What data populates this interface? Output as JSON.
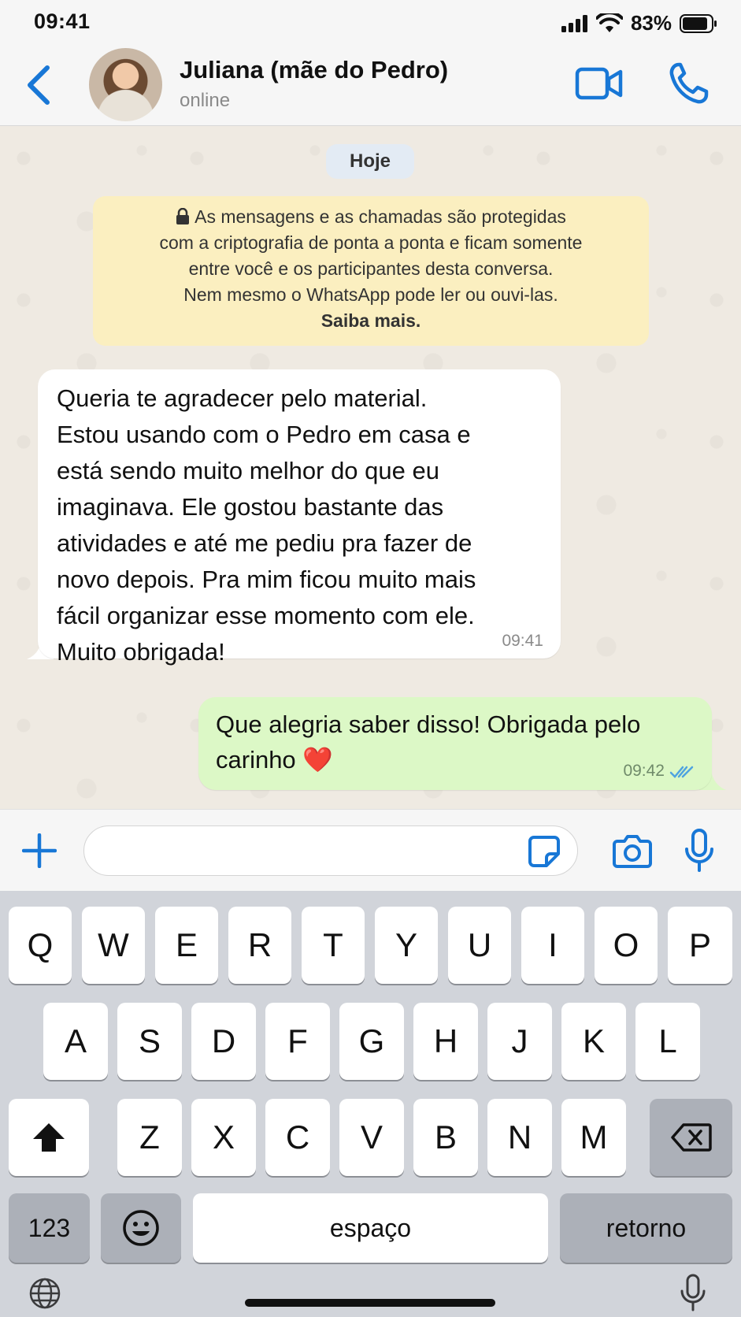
{
  "status_bar": {
    "time": "09:41",
    "battery": "83%"
  },
  "header": {
    "contact_name": "Juliana (mãe do Pedro)",
    "contact_status": "online"
  },
  "chat": {
    "date_chip": "Hoje",
    "encryption_notice": {
      "lines": [
        "As mensagens e as chamadas são protegidas",
        "com a criptografia de ponta a ponta e ficam somente",
        "entre você e os participantes desta conversa.",
        "Nem mesmo o WhatsApp pode ler ou ouvi-las."
      ],
      "learn_more": "Saiba mais."
    },
    "messages": [
      {
        "direction": "incoming",
        "lines": [
          "Queria te agradecer pelo material.",
          "Estou usando com o Pedro em casa e",
          "está sendo muito melhor do que eu",
          "imaginava. Ele gostou bastante das",
          "atividades e até me pediu pra fazer de",
          "novo depois. Pra mim ficou muito mais",
          "fácil organizar esse momento com ele.",
          "Muito obrigada!"
        ],
        "time": "09:41"
      },
      {
        "direction": "outgoing",
        "lines": [
          "Que alegria saber disso! Obrigada pelo",
          "carinho"
        ],
        "emoji": "❤️",
        "time": "09:42",
        "status": "read"
      }
    ]
  },
  "input_bar": {
    "value": "",
    "placeholder": ""
  },
  "keyboard": {
    "row1": [
      "Q",
      "W",
      "E",
      "R",
      "T",
      "Y",
      "U",
      "I",
      "O",
      "P"
    ],
    "row2": [
      "A",
      "S",
      "D",
      "F",
      "G",
      "H",
      "J",
      "K",
      "L"
    ],
    "row3": [
      "Z",
      "X",
      "C",
      "V",
      "B",
      "N",
      "M"
    ],
    "numbers_key": "123",
    "space_key": "espaço",
    "return_key": "retorno"
  },
  "colors": {
    "accent": "#1877d6",
    "incoming_bubble": "#ffffff",
    "outgoing_bubble": "#dcf8c6",
    "encryption_bg": "#fbefc0",
    "read_ticks": "#4fa3e0"
  }
}
